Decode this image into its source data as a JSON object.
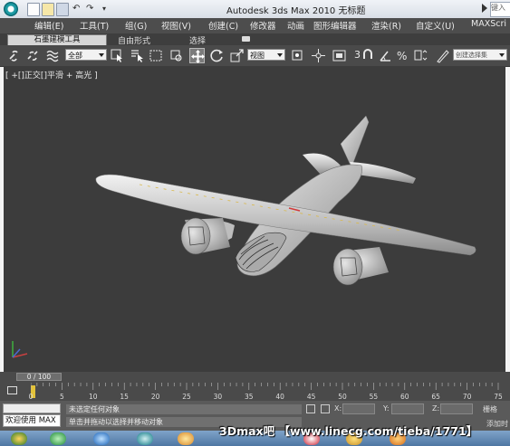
{
  "title_bar": {
    "title": "Autodesk 3ds Max  2010      无标题",
    "search_text": "键入"
  },
  "menu": {
    "items": [
      "编辑(E)",
      "工具(T)",
      "组(G)",
      "视图(V)",
      "创建(C)",
      "修改器",
      "动画",
      "图形编辑器",
      "渲染(R)",
      "自定义(U)",
      "MAXScri"
    ]
  },
  "ribbon": {
    "tabs": [
      "石墨建模工具",
      "自由形式",
      "选择"
    ]
  },
  "toolbar": {
    "filter_select": "全部",
    "coord_select": "视图",
    "named_selection_placeholder": "创建选择集",
    "snap_label": "3"
  },
  "viewport": {
    "label": "[ +[]正交[]平滑 + 高光 ]"
  },
  "time_slider": {
    "frame_display": "0 / 100",
    "ticks": [
      "0",
      "5",
      "10",
      "15",
      "20",
      "25",
      "30",
      "35",
      "40",
      "45",
      "50",
      "55",
      "60",
      "65",
      "70",
      "75"
    ]
  },
  "status": {
    "welcome": "欢迎使用 MAX",
    "line1": "未选定任何对象",
    "line2": "单击并拖动以选择并移动对象",
    "x_label": "X:",
    "y_label": "Y:",
    "z_label": "Z:",
    "grid_label": "栅格",
    "add_time_tag": "添加时"
  },
  "watermark": "3Dmax吧 【www.linecg.com/tieba/1771】",
  "colors": {
    "menubar": "#4d4d4d",
    "viewport": "#3c3c3c",
    "taskbar": "#4f77a3",
    "key_marker": "#e3c23a"
  }
}
